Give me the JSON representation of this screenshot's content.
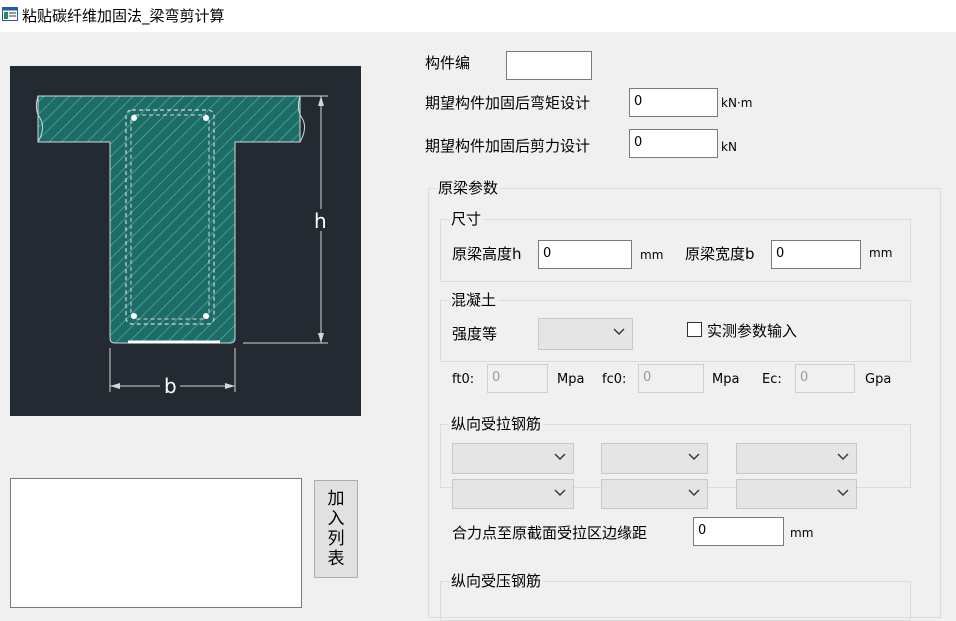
{
  "window": {
    "title": "粘贴碳纤维加固法_梁弯剪计算"
  },
  "header_fields": {
    "member_id": {
      "label": "构件编",
      "value": ""
    },
    "moment": {
      "label": "期望构件加固后弯矩设计",
      "value": "0",
      "unit": "kN·m"
    },
    "shear": {
      "label": "期望构件加固后剪力设计",
      "value": "0",
      "unit": "kN"
    }
  },
  "diagram": {
    "label_h": "h",
    "label_b": "b"
  },
  "original_beam": {
    "title": "原梁参数",
    "size": {
      "title": "尺寸",
      "height": {
        "label": "原梁高度h",
        "value": "0",
        "unit": "mm"
      },
      "width": {
        "label": "原梁宽度b",
        "value": "0",
        "unit": "mm"
      }
    },
    "concrete": {
      "title": "混凝土",
      "grade_label": "强度等",
      "grade_value": "",
      "measured_label": "实测参数输入",
      "measured_checked": false,
      "ft0": {
        "label": "ft0:",
        "value": "0",
        "unit": "Mpa"
      },
      "fc0": {
        "label": "fc0:",
        "value": "0",
        "unit": "Mpa"
      },
      "ec": {
        "label": "Ec:",
        "value": "0",
        "unit": "Gpa"
      }
    },
    "tension_rebar": {
      "title": "纵向受拉钢筋",
      "distance": {
        "label": "合力点至原截面受拉区边缘距",
        "value": "0",
        "unit": "mm"
      }
    },
    "compression_rebar": {
      "title": "纵向受压钢筋"
    }
  },
  "list": {
    "add_button_chars": [
      "加",
      "入",
      "列",
      "表"
    ]
  },
  "colors": {
    "diagram_bg": "#242a31",
    "hatch": "#2aa9a0",
    "rebar": "#ffffff"
  }
}
